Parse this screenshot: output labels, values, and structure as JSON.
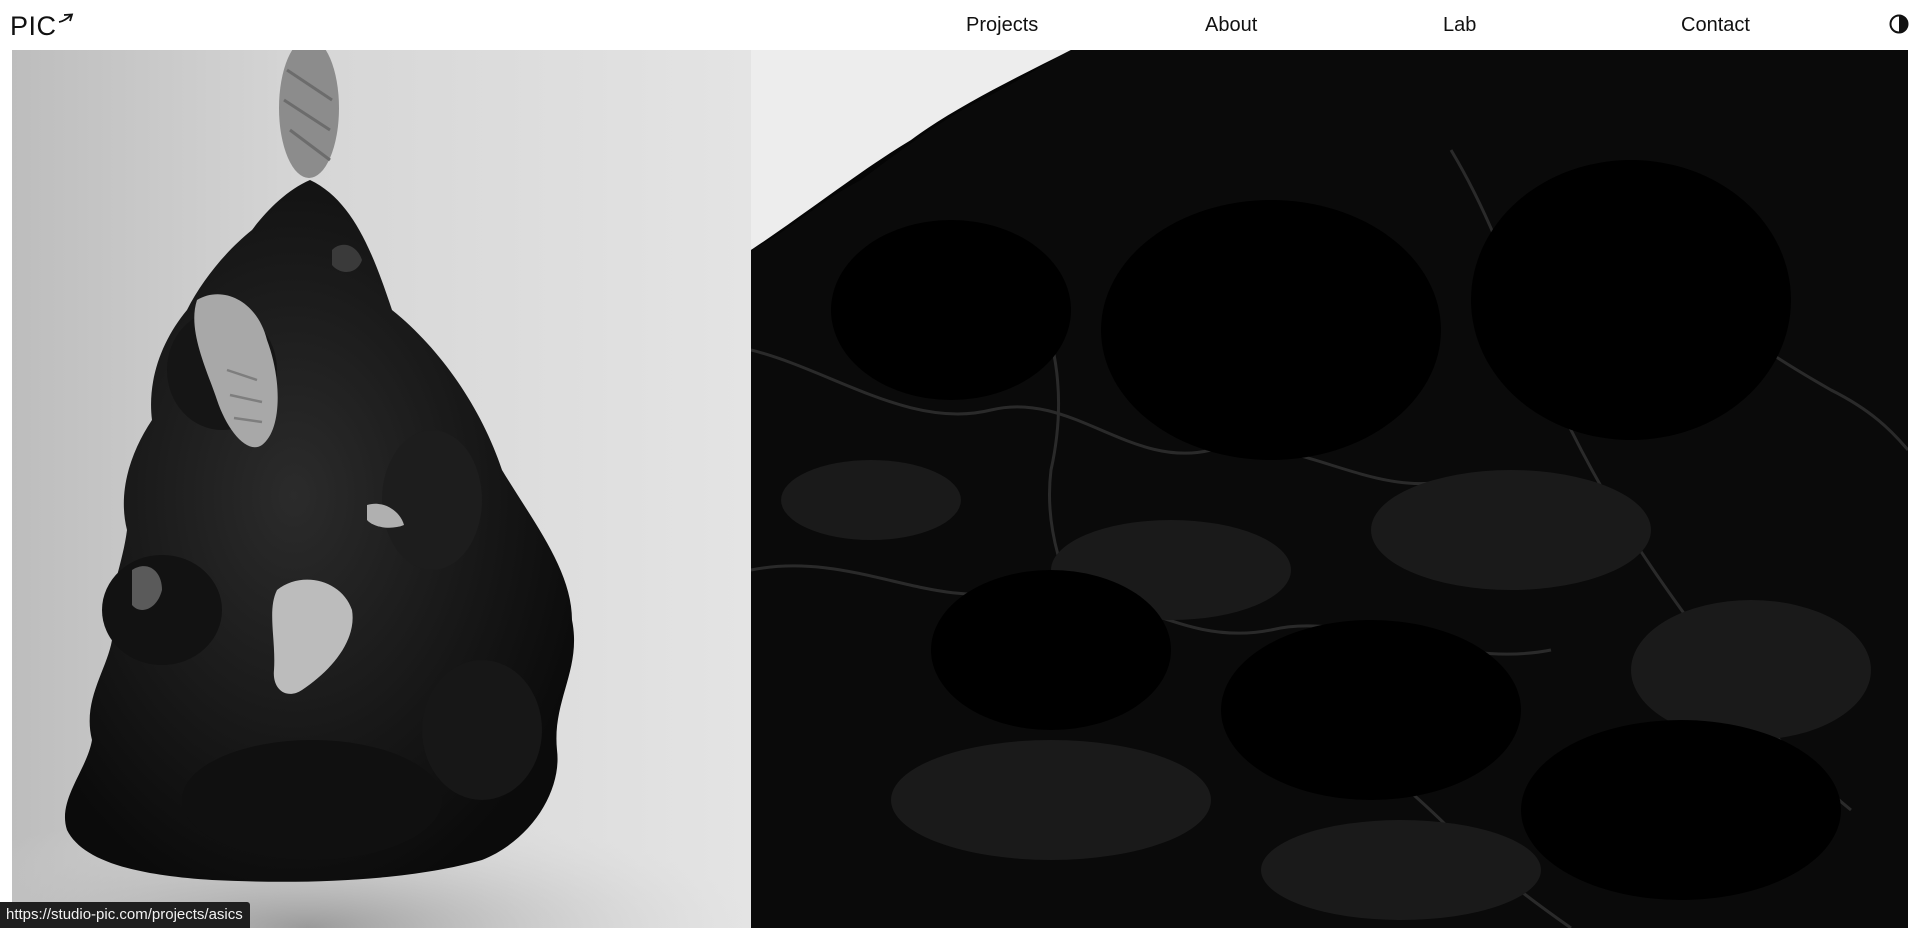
{
  "brand": {
    "logo_text": "PIC",
    "logo_icon": "arrow-icon"
  },
  "nav": {
    "projects": "Projects",
    "about": "About",
    "lab": "Lab",
    "contact": "Contact",
    "theme_icon": "half-circle-contrast-icon"
  },
  "hero": {
    "left_image": "black rock sculpture with embedded sneakers on light gray background",
    "right_image": "close-up dark rock texture"
  },
  "status_bar": {
    "url": "https://studio-pic.com/projects/asics"
  },
  "colors": {
    "background": "#ffffff",
    "text": "#111111",
    "status_bg": "#1f1f1f",
    "status_text": "#f2f2f2"
  }
}
